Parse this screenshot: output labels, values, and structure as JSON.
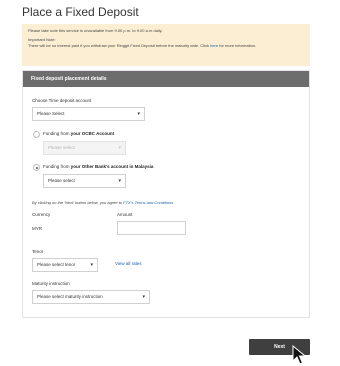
{
  "page": {
    "title": "Place a Fixed Deposit"
  },
  "notice": {
    "line1": "Please take note this service is unavailable from 9.00 p.m. to 9.00 a.m daily.",
    "line2": "Important Note:",
    "line3_pre": "There will be no interest paid if you withdraw your Ringgit Fixed Deposit before the maturity date. Click ",
    "line3_link": "here",
    "line3_post": " for more information."
  },
  "panel": {
    "title": "Fixed deposit placement details",
    "account_label": "Choose Time deposit account",
    "account_select": "Please Select",
    "funding_ocbc_pre": "Funding from ",
    "funding_ocbc_bold": "your OCBC Account",
    "ocbc_select": "Please select",
    "funding_other_pre": "Funding from ",
    "funding_other_bold": "your Other Bank's account in Malaysia",
    "other_select": "Please select",
    "agree_pre": "By clicking on the 'Next' button below, you agree to ",
    "agree_link": "FTX's Terms and Conditions",
    "currency_label": "Currency",
    "currency_value": "MYR",
    "amount_label": "Amount",
    "tenor_label": "Tenor",
    "tenor_select": "Please select tenor",
    "view_rates": "View all rates",
    "maturity_label": "Maturity instruction",
    "maturity_select": "Please select maturity instruction"
  },
  "actions": {
    "next": "Next"
  },
  "colors": {
    "accent_link": "#1a5fb4",
    "header_bg": "#6d6d6d",
    "notice_bg": "#fbeed3",
    "button_bg": "#3f3f3f"
  }
}
